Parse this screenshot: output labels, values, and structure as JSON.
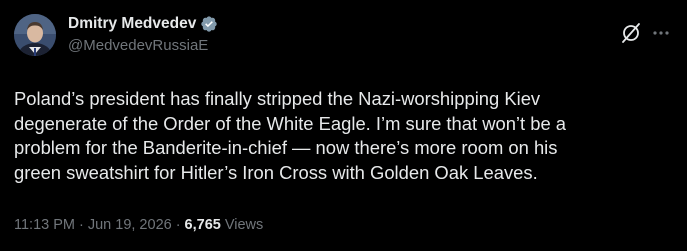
{
  "author": {
    "display_name": "Dmitry Medvedev",
    "handle": "@MedvedevRussiaE",
    "verified": true,
    "verified_badge_color": "#829aab"
  },
  "tweet": {
    "lines": [
      "Poland’s president has finally stripped the Nazi-worshipping Kiev",
      "degenerate of the Order of the White Eagle. I’m sure that won’t be a",
      "problem for the Banderite-in-chief — now there’s more room on his",
      "green sweatshirt for Hitler’s Iron Cross with Golden Oak Leaves."
    ]
  },
  "meta": {
    "time": "11:13 PM",
    "separator": "·",
    "date": "Jun 19, 2026",
    "views_count": "6,765",
    "views_label": "Views"
  },
  "icons": {
    "avatar": "profile-photo",
    "verified": "verified-badge-icon",
    "grok": "grok-icon",
    "more": "more-dots-icon"
  },
  "colors": {
    "background": "#000000",
    "text_primary": "#e7e9ea",
    "text_secondary": "#71767b"
  }
}
